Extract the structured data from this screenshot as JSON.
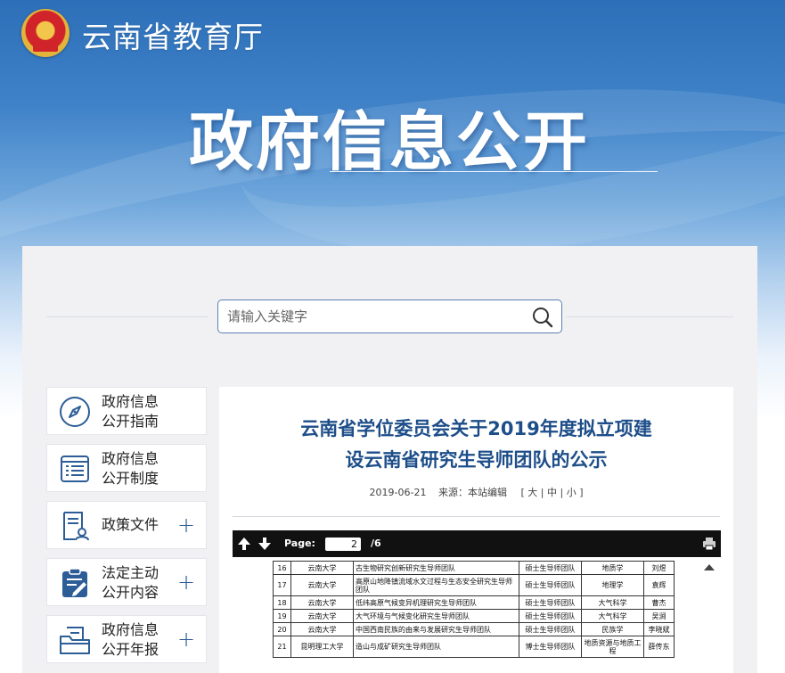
{
  "site": {
    "name": "云南省教育厅",
    "emblem_icon": "national-emblem-icon"
  },
  "banner": {
    "title": "政府信息公开"
  },
  "search": {
    "placeholder": "请输入关键字",
    "value": "",
    "icon": "search-icon"
  },
  "sidebar": {
    "items": [
      {
        "label": "政府信息\n公开指南",
        "icon": "compass-icon",
        "expandable": false
      },
      {
        "label": "政府信息\n公开制度",
        "icon": "document-list-icon",
        "expandable": false
      },
      {
        "label": "政策文件",
        "icon": "policy-file-icon",
        "expandable": true
      },
      {
        "label": "法定主动\n公开内容",
        "icon": "clipboard-edit-icon",
        "expandable": true
      },
      {
        "label": "政府信息\n公开年报",
        "icon": "folder-report-icon",
        "expandable": true
      }
    ],
    "plus": "+"
  },
  "article": {
    "title_line1": "云南省学位委员会关于2019年度拟立项建",
    "title_line2": "设云南省研究生导师团队的公示",
    "date": "2019-06-21",
    "source": "来源：本站编辑",
    "font_sizes": {
      "open": "[",
      "large": "大",
      "sep1": "|",
      "medium": "中",
      "sep2": "|",
      "small": "小",
      "close": "]"
    }
  },
  "pdf_viewer": {
    "page_label": "Page:",
    "page_value": "2",
    "page_total": "/6",
    "table_rows": [
      {
        "no": "16",
        "school": "云南大学",
        "team": "古生物研究创新研究生导师团队",
        "type": "硕士生导师团队",
        "field": "地质学",
        "leader": "刘煜"
      },
      {
        "no": "17",
        "school": "云南大学",
        "team": "高原山地降镇流域水文过程与生态安全研究生导师团队",
        "type": "硕士生导师团队",
        "field": "地理学",
        "leader": "袁辉"
      },
      {
        "no": "18",
        "school": "云南大学",
        "team": "低纬高原气候变异机理研究生导师团队",
        "type": "硕士生导师团队",
        "field": "大气科学",
        "leader": "曹杰"
      },
      {
        "no": "19",
        "school": "云南大学",
        "team": "大气环境与气候变化研究生导师团队",
        "type": "硕士生导师团队",
        "field": "大气科学",
        "leader": "吴涧"
      },
      {
        "no": "20",
        "school": "云南大学",
        "team": "中国西南民族的由来与发展研究生导师团队",
        "type": "硕士生导师团队",
        "field": "民族学",
        "leader": "李晓斌"
      },
      {
        "no": "21",
        "school": "昆明理工大学",
        "team": "造山与成矿研究生导师团队",
        "type": "博士生导师团队",
        "field": "地质资源与地质工程",
        "leader": "薛传东"
      }
    ]
  }
}
